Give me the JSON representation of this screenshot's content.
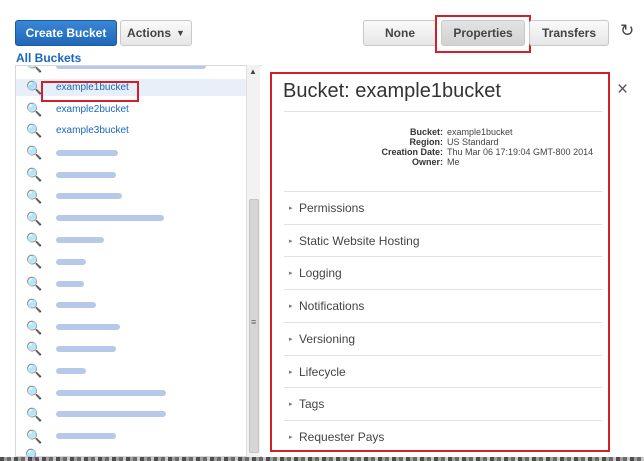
{
  "toolbar": {
    "create_bucket": "Create Bucket",
    "actions": "Actions",
    "none": "None",
    "properties": "Properties",
    "transfers": "Transfers",
    "refresh_icon": "refresh-icon"
  },
  "all_buckets_label": "All Buckets",
  "buckets": [
    {
      "name": "",
      "blurred": true,
      "blur_width": 150
    },
    {
      "name": "example1bucket",
      "selected": true
    },
    {
      "name": "example2bucket"
    },
    {
      "name": "example3bucket"
    },
    {
      "name": "",
      "blurred": true,
      "blur_width": 62
    },
    {
      "name": "",
      "blurred": true,
      "blur_width": 60
    },
    {
      "name": "",
      "blurred": true,
      "blur_width": 66
    },
    {
      "name": "",
      "blurred": true,
      "blur_width": 108
    },
    {
      "name": "",
      "blurred": true,
      "blur_width": 48
    },
    {
      "name": "",
      "blurred": true,
      "blur_width": 30
    },
    {
      "name": "",
      "blurred": true,
      "blur_width": 28
    },
    {
      "name": "",
      "blurred": true,
      "blur_width": 40
    },
    {
      "name": "",
      "blurred": true,
      "blur_width": 64
    },
    {
      "name": "",
      "blurred": true,
      "blur_width": 60
    },
    {
      "name": "",
      "blurred": true,
      "blur_width": 30
    },
    {
      "name": "",
      "blurred": true,
      "blur_width": 110
    },
    {
      "name": "",
      "blurred": true,
      "blur_width": 110
    },
    {
      "name": "",
      "blurred": true,
      "blur_width": 60
    }
  ],
  "properties": {
    "title": "Bucket: example1bucket",
    "close_icon": "close-icon",
    "meta": [
      {
        "key": "Bucket:",
        "value": "example1bucket"
      },
      {
        "key": "Region:",
        "value": "US Standard"
      },
      {
        "key": "Creation Date:",
        "value": "Thu Mar 06 17:19:04 GMT-800 2014"
      },
      {
        "key": "Owner:",
        "value": "Me"
      }
    ],
    "sections": [
      "Permissions",
      "Static Website Hosting",
      "Logging",
      "Notifications",
      "Versioning",
      "Lifecycle",
      "Tags",
      "Requester Pays"
    ]
  },
  "colors": {
    "accent": "#1a66c2",
    "highlight": "#d0212a",
    "primary_button": "#2a77c9"
  }
}
